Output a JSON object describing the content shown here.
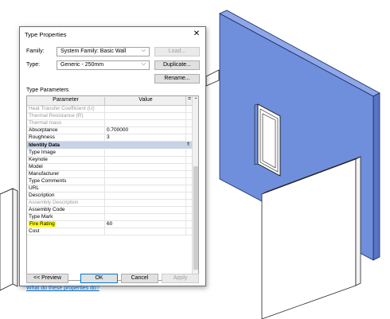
{
  "dialog": {
    "title": "Type Properties",
    "family_label": "Family:",
    "family_value": "System Family: Basic Wall",
    "type_label": "Type:",
    "type_value": "Generic - 250mm",
    "load_button": "Load...",
    "duplicate_button": "Duplicate...",
    "rename_button": "Rename...",
    "section_label": "Type Parameters",
    "table": {
      "header_parameter": "Parameter",
      "header_value": "Value",
      "header_eq": "=",
      "rows_top": [
        {
          "name": "Heat Transfer Coefficient (U)",
          "value": "",
          "greyed": true
        },
        {
          "name": "Thermal Resistance (R)",
          "value": "",
          "greyed": true
        },
        {
          "name": "Thermal mass",
          "value": "",
          "greyed": true
        },
        {
          "name": "Absorptance",
          "value": "0.700000",
          "greyed": false
        },
        {
          "name": "Roughness",
          "value": "3",
          "greyed": false
        }
      ],
      "group_name": "Identity Data",
      "group_toggle": "⇑",
      "rows_identity": [
        {
          "name": "Type Image",
          "value": "",
          "greyed": false
        },
        {
          "name": "Keynote",
          "value": "",
          "greyed": false
        },
        {
          "name": "Model",
          "value": "",
          "greyed": false
        },
        {
          "name": "Manufacturer",
          "value": "",
          "greyed": false
        },
        {
          "name": "Type Comments",
          "value": "",
          "greyed": false
        },
        {
          "name": "URL",
          "value": "",
          "greyed": false
        },
        {
          "name": "Description",
          "value": "",
          "greyed": false
        },
        {
          "name": "Assembly Description",
          "value": "",
          "greyed": true
        },
        {
          "name": "Assembly Code",
          "value": "",
          "greyed": false
        },
        {
          "name": "Type Mark",
          "value": "",
          "greyed": false
        },
        {
          "name": "Fire Rating",
          "value": "60",
          "greyed": false,
          "highlighted": true
        },
        {
          "name": "Cost",
          "value": "",
          "greyed": false
        }
      ]
    },
    "help_link": "What do these properties do?",
    "preview_button": "<< Preview",
    "ok_button": "OK",
    "cancel_button": "Cancel",
    "apply_button": "Apply"
  },
  "colors": {
    "wall_front": "#6f8fdc",
    "wall_side": "#5874c4",
    "highlight": "#ffff00",
    "group_header": "#c7d3e5",
    "link": "#0066cc"
  }
}
